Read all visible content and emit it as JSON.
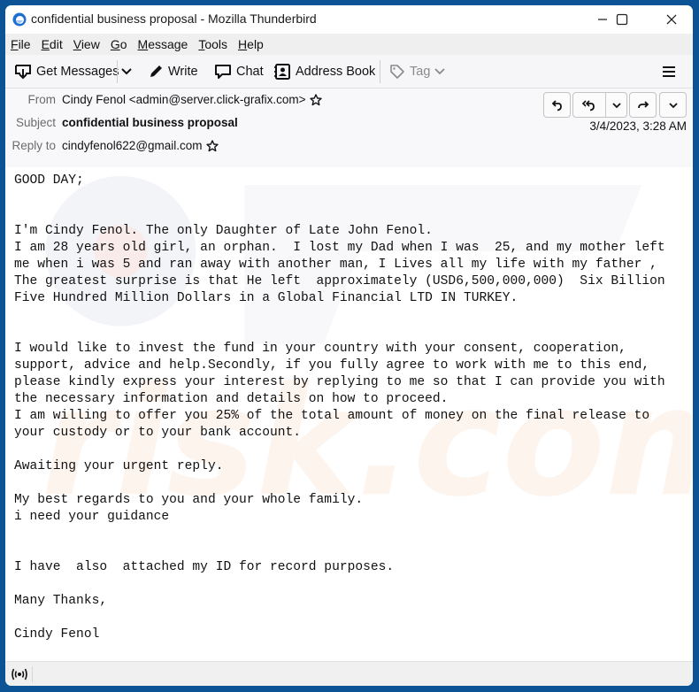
{
  "window": {
    "title": "confidential business proposal - Mozilla Thunderbird",
    "controls": [
      "minimize",
      "maximize",
      "close"
    ]
  },
  "menubar": {
    "items": [
      {
        "label": "File",
        "accel": "F",
        "rest": "ile"
      },
      {
        "label": "Edit",
        "accel": "E",
        "rest": "dit"
      },
      {
        "label": "View",
        "accel": "V",
        "rest": "iew"
      },
      {
        "label": "Go",
        "accel": "G",
        "rest": "o"
      },
      {
        "label": "Message",
        "accel": "M",
        "rest": "essage"
      },
      {
        "label": "Tools",
        "accel": "T",
        "rest": "ools"
      },
      {
        "label": "Help",
        "accel": "H",
        "rest": "elp"
      }
    ]
  },
  "toolbar": {
    "get_messages": "Get Messages",
    "write": "Write",
    "chat": "Chat",
    "address_book": "Address Book",
    "tag": "Tag"
  },
  "header": {
    "from_label": "From",
    "from_value": "Cindy Fenol <admin@server.click-grafix.com>",
    "subject_label": "Subject",
    "subject_value": "confidential business proposal",
    "reply_to_label": "Reply to",
    "reply_to_value": "cindyfenol622@gmail.com",
    "date": "3/4/2023, 3:28 AM",
    "actions": [
      "reply",
      "reply-all",
      "reply-all-menu",
      "forward",
      "more"
    ]
  },
  "message": {
    "body": "GOOD DAY;\n\n\nI'm Cindy Fenol. The only Daughter of Late John Fenol.\nI am 28 years old girl, an orphan.  I lost my Dad when I was  25, and my mother left\nme when i was 5 and ran away with another man, I Lives all my life with my father ,\nThe greatest surprise is that He left  approximately (USD6,500,000,000)  Six Billion\nFive Hundred Million Dollars in a Global Financial LTD IN TURKEY.\n\n\nI would like to invest the fund in your country with your consent, cooperation,\nsupport, advice and help.Secondly, if you fully agree to work with me to this end,\nplease kindly express your interest by replying to me so that I can provide you with\nthe necessary information and details on how to proceed.\nI am willing to offer you 25% of the total amount of money on the final release to\nyour custody or to your bank account.\n\nAwaiting your urgent reply.\n\nMy best regards to you and your whole family.\ni need your guidance\n\n\nI have  also  attached my ID for record purposes.\n\nMany Thanks,\n\nCindy Fenol"
  },
  "colors": {
    "frame": "#0b5394",
    "menubar_bg": "#efefef",
    "toolbar_bg": "#f6f6f8",
    "header_bg": "#f8f8fa"
  }
}
